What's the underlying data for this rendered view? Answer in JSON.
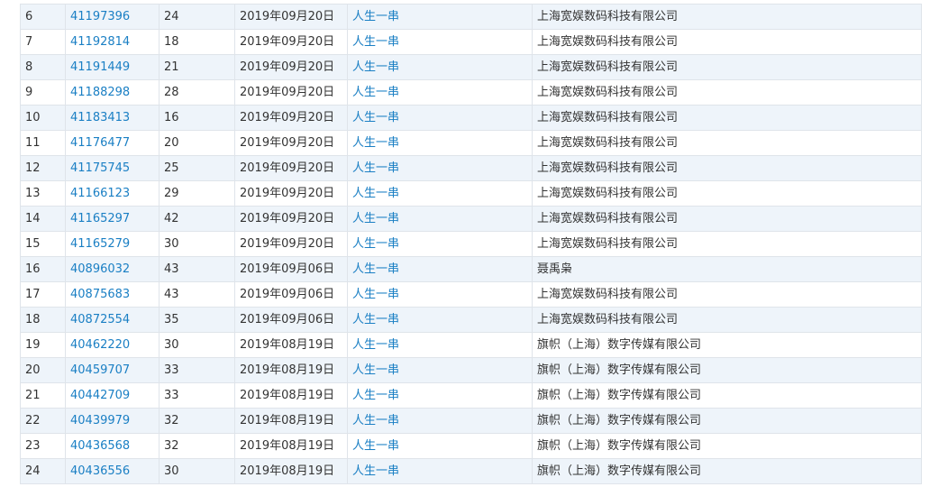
{
  "theme": {
    "link_color": "#1a7fc4",
    "text_color": "#333333",
    "row_alt_bg": "#eef4fa",
    "border_color": "#dfe4ea"
  },
  "table": {
    "rows": [
      {
        "idx": "6",
        "reg_no": "41197396",
        "class": "24",
        "date": "2019年09月20日",
        "name": "人生一串",
        "applicant": "上海宽娱数码科技有限公司"
      },
      {
        "idx": "7",
        "reg_no": "41192814",
        "class": "18",
        "date": "2019年09月20日",
        "name": "人生一串",
        "applicant": "上海宽娱数码科技有限公司"
      },
      {
        "idx": "8",
        "reg_no": "41191449",
        "class": "21",
        "date": "2019年09月20日",
        "name": "人生一串",
        "applicant": "上海宽娱数码科技有限公司"
      },
      {
        "idx": "9",
        "reg_no": "41188298",
        "class": "28",
        "date": "2019年09月20日",
        "name": "人生一串",
        "applicant": "上海宽娱数码科技有限公司"
      },
      {
        "idx": "10",
        "reg_no": "41183413",
        "class": "16",
        "date": "2019年09月20日",
        "name": "人生一串",
        "applicant": "上海宽娱数码科技有限公司"
      },
      {
        "idx": "11",
        "reg_no": "41176477",
        "class": "20",
        "date": "2019年09月20日",
        "name": "人生一串",
        "applicant": "上海宽娱数码科技有限公司"
      },
      {
        "idx": "12",
        "reg_no": "41175745",
        "class": "25",
        "date": "2019年09月20日",
        "name": "人生一串",
        "applicant": "上海宽娱数码科技有限公司"
      },
      {
        "idx": "13",
        "reg_no": "41166123",
        "class": "29",
        "date": "2019年09月20日",
        "name": "人生一串",
        "applicant": "上海宽娱数码科技有限公司"
      },
      {
        "idx": "14",
        "reg_no": "41165297",
        "class": "42",
        "date": "2019年09月20日",
        "name": "人生一串",
        "applicant": "上海宽娱数码科技有限公司"
      },
      {
        "idx": "15",
        "reg_no": "41165279",
        "class": "30",
        "date": "2019年09月20日",
        "name": "人生一串",
        "applicant": "上海宽娱数码科技有限公司"
      },
      {
        "idx": "16",
        "reg_no": "40896032",
        "class": "43",
        "date": "2019年09月06日",
        "name": "人生一串",
        "applicant": "聂禹枭"
      },
      {
        "idx": "17",
        "reg_no": "40875683",
        "class": "43",
        "date": "2019年09月06日",
        "name": "人生一串",
        "applicant": "上海宽娱数码科技有限公司"
      },
      {
        "idx": "18",
        "reg_no": "40872554",
        "class": "35",
        "date": "2019年09月06日",
        "name": "人生一串",
        "applicant": "上海宽娱数码科技有限公司"
      },
      {
        "idx": "19",
        "reg_no": "40462220",
        "class": "30",
        "date": "2019年08月19日",
        "name": "人生一串",
        "applicant": "旗帜（上海）数字传媒有限公司"
      },
      {
        "idx": "20",
        "reg_no": "40459707",
        "class": "33",
        "date": "2019年08月19日",
        "name": "人生一串",
        "applicant": "旗帜（上海）数字传媒有限公司"
      },
      {
        "idx": "21",
        "reg_no": "40442709",
        "class": "33",
        "date": "2019年08月19日",
        "name": "人生一串",
        "applicant": "旗帜（上海）数字传媒有限公司"
      },
      {
        "idx": "22",
        "reg_no": "40439979",
        "class": "32",
        "date": "2019年08月19日",
        "name": "人生一串",
        "applicant": "旗帜（上海）数字传媒有限公司"
      },
      {
        "idx": "23",
        "reg_no": "40436568",
        "class": "32",
        "date": "2019年08月19日",
        "name": "人生一串",
        "applicant": "旗帜（上海）数字传媒有限公司"
      },
      {
        "idx": "24",
        "reg_no": "40436556",
        "class": "30",
        "date": "2019年08月19日",
        "name": "人生一串",
        "applicant": "旗帜（上海）数字传媒有限公司"
      }
    ]
  }
}
